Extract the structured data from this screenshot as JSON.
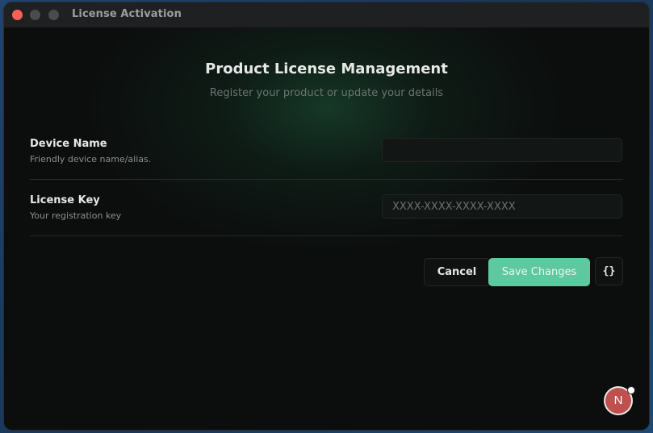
{
  "window": {
    "title": "License Activation"
  },
  "header": {
    "title": "Product License Management",
    "subtitle": "Register your product or update your details"
  },
  "form": {
    "fields": [
      {
        "label": "Device Name",
        "help": "Friendly device name/alias.",
        "value": "",
        "placeholder": ""
      },
      {
        "label": "License Key",
        "help": "Your registration key",
        "value": "",
        "placeholder": "XXXX-XXXX-XXXX-XXXX"
      }
    ]
  },
  "actions": {
    "cancel_label": "Cancel",
    "save_label": "Save Changes",
    "code_label": "{}"
  },
  "avatar": {
    "initial": "N"
  },
  "colors": {
    "accent": "#5ec9a0",
    "close": "#fe5f57",
    "avatar": "#c0504d"
  }
}
